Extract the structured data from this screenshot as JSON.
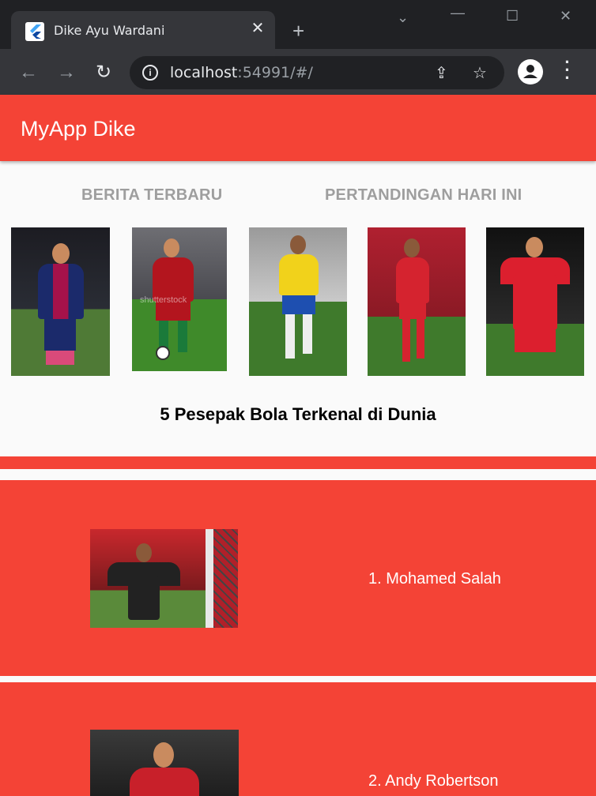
{
  "browser": {
    "tab_title": "Dike Ayu Wardani",
    "url_host": "localhost",
    "url_rest": ":54991/#/"
  },
  "app": {
    "title": "MyApp Dike",
    "tabs": [
      {
        "label": "BERITA TERBARU"
      },
      {
        "label": "PERTANDINGAN HARI INI"
      }
    ],
    "gallery_watermark": "shutterstock",
    "headline": "5 Pesepak Bola Terkenal di Dunia",
    "players": [
      {
        "name": "1. Mohamed Salah"
      },
      {
        "name": "2. Andy Robertson"
      }
    ]
  },
  "colors": {
    "primary": "#f44336",
    "tab_text": "#9e9e9e"
  },
  "icons": [
    "flutter-icon",
    "close-icon",
    "plus-icon",
    "back-icon",
    "forward-icon",
    "reload-icon",
    "info-icon",
    "share-icon",
    "star-icon",
    "profile-icon",
    "menu-icon"
  ]
}
